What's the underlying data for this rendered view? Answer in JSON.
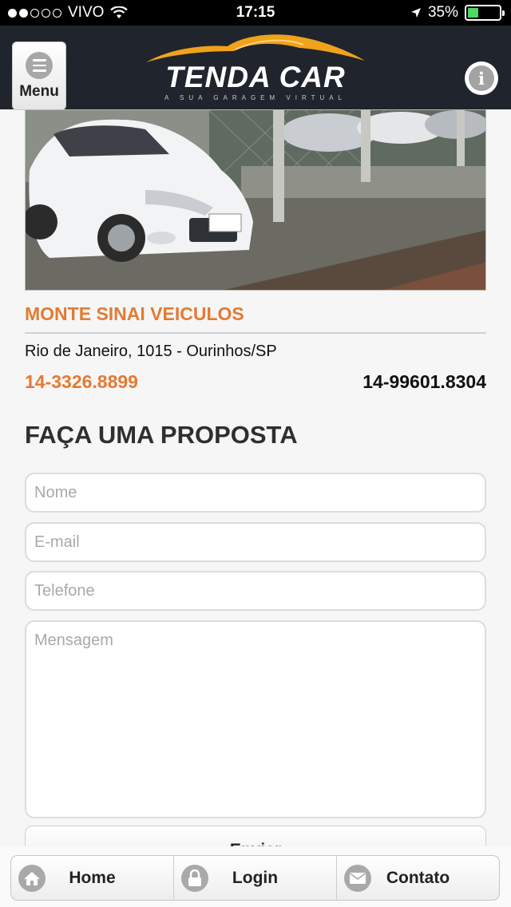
{
  "status_bar": {
    "carrier": "VIVO",
    "time": "17:15",
    "battery": "35%",
    "battery_level": 0.35
  },
  "header": {
    "menu_label": "Menu",
    "logo_text": "TENDA CAR",
    "logo_tagline": "A SUA GARAGEM VIRTUAL"
  },
  "dealer": {
    "name": "MONTE SINAI VEICULOS",
    "address": "Rio de Janeiro, 1015 - Ourinhos/SP",
    "phone_1": "14-3326.8899",
    "phone_2": "14-99601.8304"
  },
  "form": {
    "title": "FAÇA UMA PROPOSTA",
    "name_placeholder": "Nome",
    "email_placeholder": "E-mail",
    "phone_placeholder": "Telefone",
    "message_placeholder": "Mensagem",
    "submit_label": "Enviar"
  },
  "bottom_nav": {
    "home": "Home",
    "login": "Login",
    "contact": "Contato"
  },
  "colors": {
    "accent": "#e47a33",
    "header_bg": "#20242d",
    "logo_swoosh": "#f0a21a"
  }
}
